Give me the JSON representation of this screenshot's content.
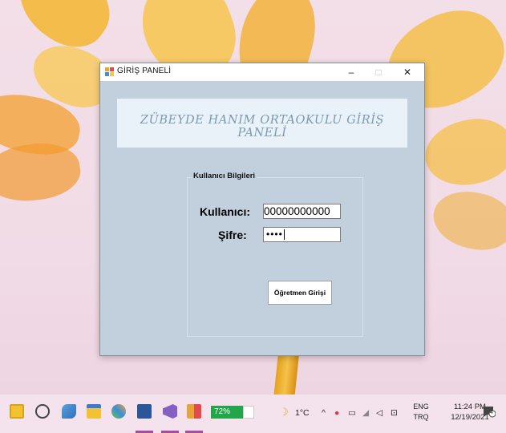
{
  "window": {
    "title": "GİRİŞ PANELİ",
    "minimize": "–",
    "maximize": "□",
    "close": "✕"
  },
  "banner": {
    "text": "ZÜBEYDE HANIM ORTAOKULU GİRİŞ PANELİ"
  },
  "group": {
    "legend": "Kullanıcı Bilgileri"
  },
  "form": {
    "username_label": "Kullanıcı:",
    "username_value": "00000000000",
    "password_label": "Şifre:",
    "password_value": "••••",
    "login_button": "Öğretmen Girişi"
  },
  "taskbar": {
    "battery_percent": "72%",
    "weather": "1°C",
    "lang_line1": "ENG",
    "lang_line2": "TRQ",
    "time": "11:24 PM",
    "date": "12/19/2021",
    "notification_count": "4",
    "icons": [
      "sticky-notes-icon",
      "snipping-icon",
      "gaming-icon",
      "file-explorer-icon",
      "color-picker-icon",
      "word-icon",
      "visual-studio-icon",
      "winforms-app-icon"
    ],
    "accent": "#a94ca0"
  }
}
